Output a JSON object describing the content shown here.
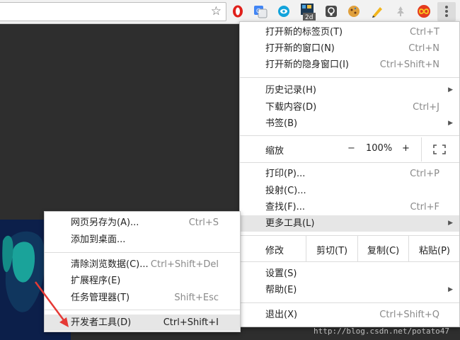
{
  "toolbar": {
    "extensions": [
      "opera-icon",
      "translate-icon",
      "vpn-icon",
      "2d-icon",
      "lightbulb-icon",
      "cookie-icon",
      "pencil-icon",
      "tree-icon",
      "infinity-icon"
    ],
    "badge_2d": "2d"
  },
  "menu": {
    "new_tab": {
      "label": "打开新的标签页(T)",
      "shortcut": "Ctrl+T"
    },
    "new_window": {
      "label": "打开新的窗口(N)",
      "shortcut": "Ctrl+N"
    },
    "incognito": {
      "label": "打开新的隐身窗口(I)",
      "shortcut": "Ctrl+Shift+N"
    },
    "history": {
      "label": "历史记录(H)"
    },
    "downloads": {
      "label": "下载内容(D)",
      "shortcut": "Ctrl+J"
    },
    "bookmarks": {
      "label": "书签(B)"
    },
    "zoom": {
      "label": "缩放",
      "minus": "−",
      "value": "100%",
      "plus": "+"
    },
    "print": {
      "label": "打印(P)...",
      "shortcut": "Ctrl+P"
    },
    "cast": {
      "label": "投射(C)..."
    },
    "find": {
      "label": "查找(F)...",
      "shortcut": "Ctrl+F"
    },
    "more_tools": {
      "label": "更多工具(L)"
    },
    "edit": {
      "label": "修改",
      "cut": "剪切(T)",
      "copy": "复制(C)",
      "paste": "粘贴(P)"
    },
    "settings": {
      "label": "设置(S)"
    },
    "help": {
      "label": "帮助(E)"
    },
    "exit": {
      "label": "退出(X)",
      "shortcut": "Ctrl+Shift+Q"
    }
  },
  "submenu": {
    "save_as": {
      "label": "网页另存为(A)...",
      "shortcut": "Ctrl+S"
    },
    "add_to_desktop": {
      "label": "添加到桌面..."
    },
    "clear_data": {
      "label": "清除浏览数据(C)...",
      "shortcut": "Ctrl+Shift+Del"
    },
    "extensions": {
      "label": "扩展程序(E)"
    },
    "task_manager": {
      "label": "任务管理器(T)",
      "shortcut": "Shift+Esc"
    },
    "dev_tools": {
      "label": "开发者工具(D)",
      "shortcut": "Ctrl+Shift+I"
    }
  },
  "watermark": "http://blog.csdn.net/potato47",
  "colors": {
    "highlight": "#e6e6e6",
    "annotation_arrow": "#e53935",
    "art_teal": "#1aa39a",
    "art_navy": "#0c1f4a"
  }
}
